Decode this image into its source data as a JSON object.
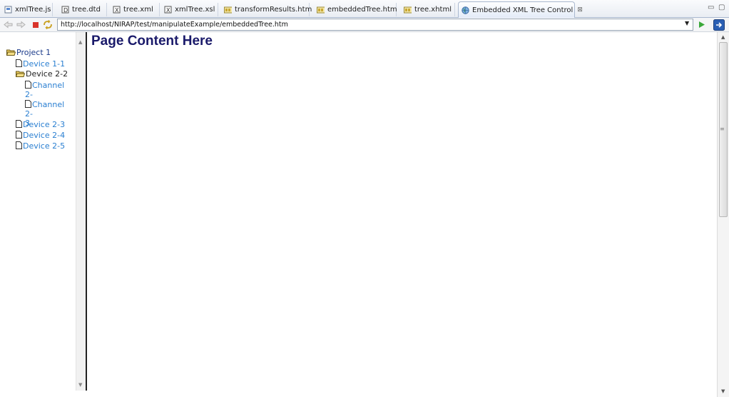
{
  "tabs": [
    {
      "label": "xmlTree.js",
      "icon": "js-file-icon"
    },
    {
      "label": "tree.dtd",
      "icon": "dtd-file-icon"
    },
    {
      "label": "tree.xml",
      "icon": "xml-file-icon"
    },
    {
      "label": "xmlTree.xsl",
      "icon": "xsl-file-icon"
    },
    {
      "label": "transformResults.htm",
      "icon": "html-file-icon"
    },
    {
      "label": "embeddedTree.htm",
      "icon": "html-file-icon"
    },
    {
      "label": "tree.xhtml",
      "icon": "html-file-icon"
    },
    {
      "label": "Embedded XML Tree Control",
      "icon": "globe-icon",
      "active": true
    }
  ],
  "browser": {
    "url": "http://localhost/NIRAP/test/manipulateExample/embeddedTree.htm"
  },
  "tree": {
    "root": "Project 1",
    "items": [
      {
        "label": "Device 1-1"
      },
      {
        "label": "Device 2-2"
      },
      {
        "label": "Channel",
        "label2": "2-2"
      },
      {
        "label": "Channel",
        "label2": "2-3"
      },
      {
        "label": "Device 2-3"
      },
      {
        "label": "Device 2-4"
      },
      {
        "label": "Device 2-5"
      }
    ]
  },
  "page": {
    "title": "Page Content Here"
  },
  "colors": {
    "link": "#2a7fd1",
    "title": "#1a1a6a"
  }
}
